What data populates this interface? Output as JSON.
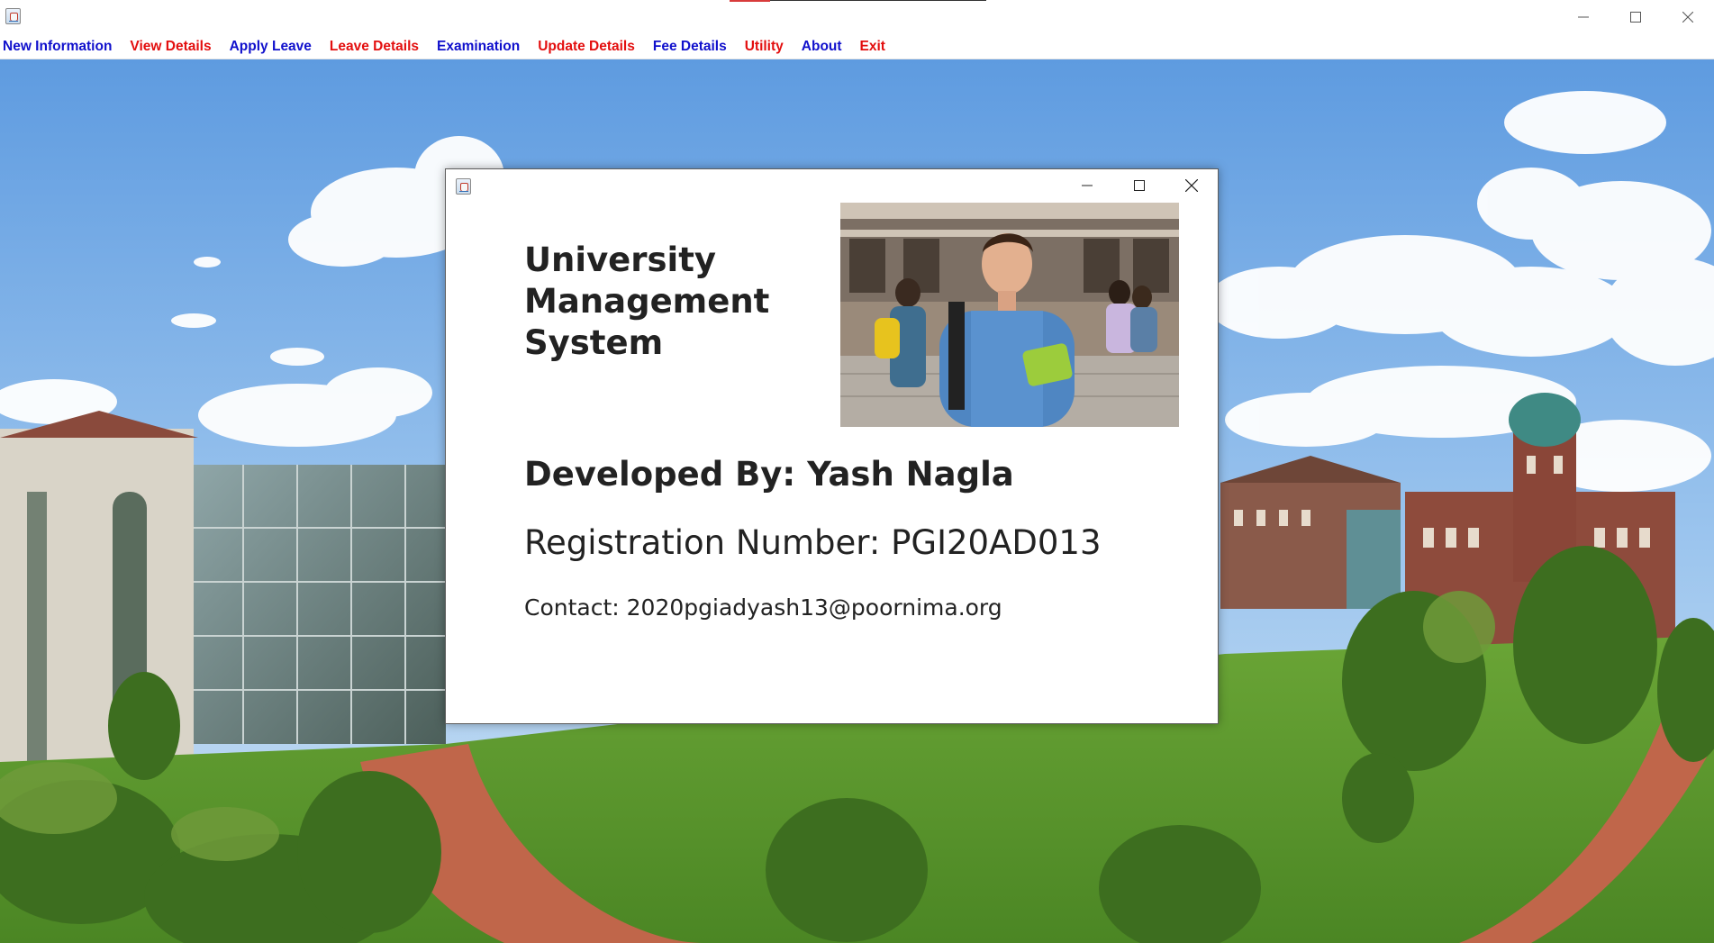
{
  "main_window": {
    "menu": [
      {
        "label": "New Information",
        "color": "#1010cc"
      },
      {
        "label": "View Details",
        "color": "#e30e0e"
      },
      {
        "label": "Apply Leave",
        "color": "#1010cc"
      },
      {
        "label": "Leave Details",
        "color": "#e30e0e"
      },
      {
        "label": "Examination",
        "color": "#1010cc"
      },
      {
        "label": "Update Details",
        "color": "#e30e0e"
      },
      {
        "label": "Fee Details",
        "color": "#1010cc"
      },
      {
        "label": "Utility",
        "color": "#e30e0e"
      },
      {
        "label": "About",
        "color": "#1010cc"
      },
      {
        "label": "Exit",
        "color": "#e30e0e"
      }
    ],
    "window_controls": [
      "minimize-icon",
      "maximize-icon",
      "close-icon"
    ]
  },
  "about_dialog": {
    "window_controls": [
      "minimize-icon",
      "maximize-icon",
      "close-icon"
    ],
    "title_lines": [
      "University",
      "Management",
      "System"
    ],
    "developer": "Developed By: Yash Nagla",
    "registration": "Registration Number: PGI20AD013",
    "contact": "Contact: 2020pgiadyash13@poornima.org"
  },
  "colors": {
    "menu_blue": "#1010cc",
    "menu_red": "#e30e0e",
    "dialog_text": "#222222",
    "sky": "#7fb4e8",
    "grass": "#5f9a2e"
  }
}
